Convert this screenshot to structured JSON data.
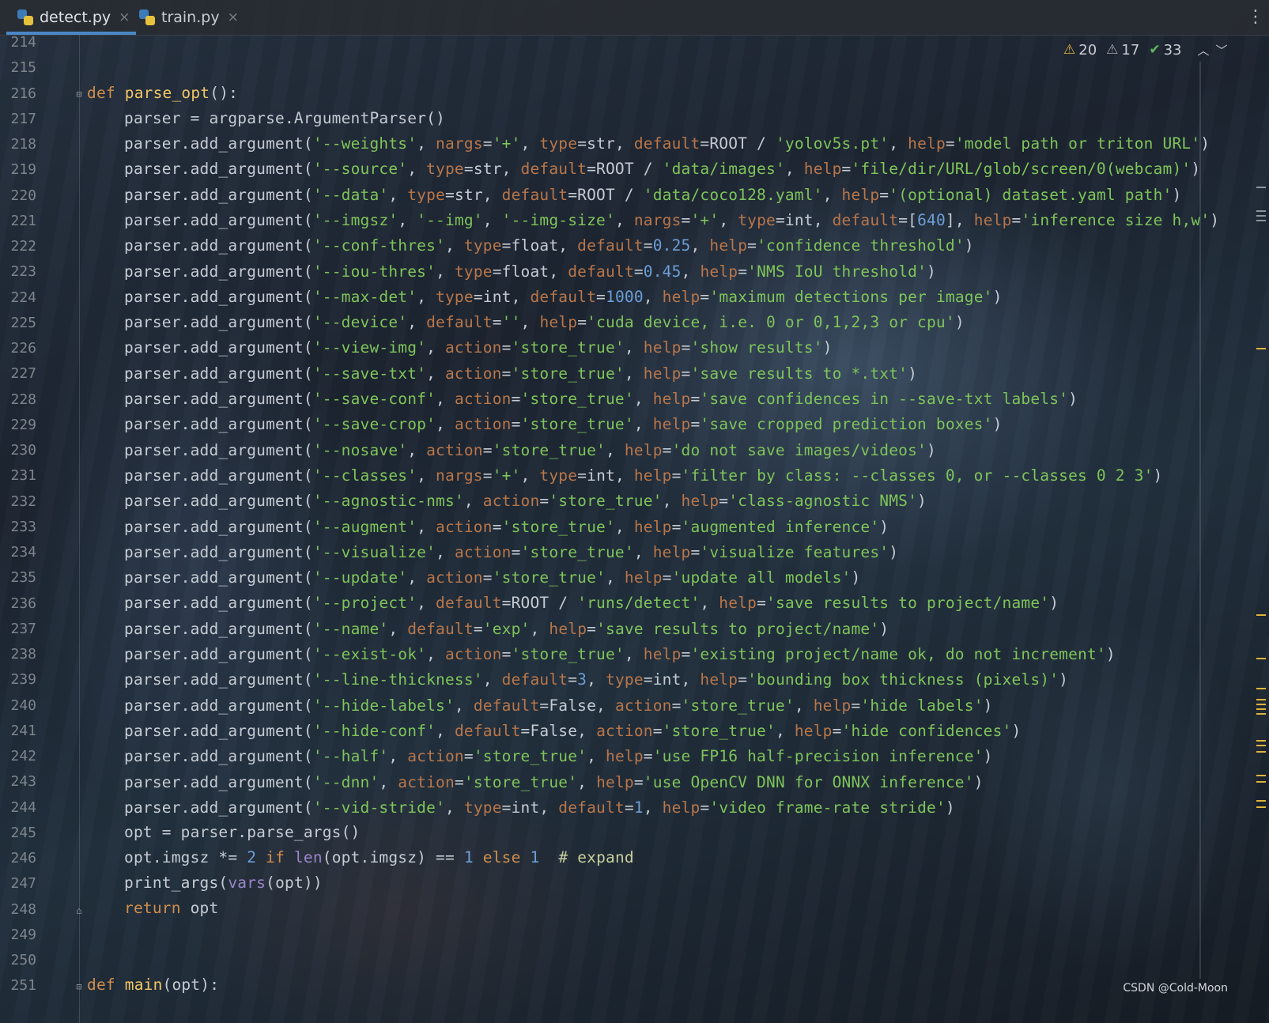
{
  "tabs": [
    {
      "label": "detect.py",
      "active": true
    },
    {
      "label": "train.py",
      "active": false
    }
  ],
  "inspections": {
    "warnings": "20",
    "weak_warnings": "17",
    "typos_ok": "33"
  },
  "colors": {
    "keyword": "#cf8e4c",
    "function": "#f1c666",
    "string": "#7fc45a",
    "number": "#6c9fd6",
    "kwarg": "#b8764a",
    "builtin": "#9b86c9",
    "accent": "#4a88c7"
  },
  "line_numbers": [
    "214",
    "215",
    "216",
    "217",
    "218",
    "219",
    "220",
    "221",
    "222",
    "223",
    "224",
    "225",
    "226",
    "227",
    "228",
    "229",
    "230",
    "231",
    "232",
    "233",
    "234",
    "235",
    "236",
    "237",
    "238",
    "239",
    "240",
    "241",
    "242",
    "243",
    "244",
    "245",
    "246",
    "247",
    "248",
    "249",
    "250",
    "251"
  ],
  "code": {
    "l216": {
      "kw": "def",
      "fn": "parse_opt",
      "rest": "():"
    },
    "l217": "parser = argparse.ArgumentParser()",
    "call": "parser.add_argument(",
    "l218": [
      "'--weights'",
      ", ",
      "nargs",
      "=",
      "'+'",
      ", ",
      "type",
      "=str, ",
      "default",
      "=ROOT / ",
      "'yolov5s.pt'",
      ", ",
      "help",
      "=",
      "'model path or triton URL'",
      ")"
    ],
    "l219": [
      "'--source'",
      ", ",
      "type",
      "=str, ",
      "default",
      "=ROOT / ",
      "'data/images'",
      ", ",
      "help",
      "=",
      "'file/dir/URL/glob/screen/0(webcam)'",
      ")"
    ],
    "l220": [
      "'--data'",
      ", ",
      "type",
      "=str, ",
      "default",
      "=ROOT / ",
      "'data/coco128.yaml'",
      ", ",
      "help",
      "=",
      "'(optional) dataset.yaml path'",
      ")"
    ],
    "l221": [
      "'--imgsz'",
      ", ",
      "'--img'",
      ", ",
      "'--img-size'",
      ", ",
      "nargs",
      "=",
      "'+'",
      ", ",
      "type",
      "=int, ",
      "default",
      "=[",
      "640",
      "], ",
      "help",
      "=",
      "'inference size h,w'",
      ")"
    ],
    "l222": [
      "'--conf-thres'",
      ", ",
      "type",
      "=float, ",
      "default",
      "=",
      "0.25",
      ", ",
      "help",
      "=",
      "'confidence threshold'",
      ")"
    ],
    "l223": [
      "'--iou-thres'",
      ", ",
      "type",
      "=float, ",
      "default",
      "=",
      "0.45",
      ", ",
      "help",
      "=",
      "'NMS IoU threshold'",
      ")"
    ],
    "l224": [
      "'--max-det'",
      ", ",
      "type",
      "=int, ",
      "default",
      "=",
      "1000",
      ", ",
      "help",
      "=",
      "'maximum detections per image'",
      ")"
    ],
    "l225": [
      "'--device'",
      ", ",
      "default",
      "=",
      "''",
      ", ",
      "help",
      "=",
      "'cuda device, i.e. 0 or 0,1,2,3 or cpu'",
      ")"
    ],
    "l226": [
      "'--view-img'",
      ", ",
      "action",
      "=",
      "'store_true'",
      ", ",
      "help",
      "=",
      "'show results'",
      ")"
    ],
    "l227": [
      "'--save-txt'",
      ", ",
      "action",
      "=",
      "'store_true'",
      ", ",
      "help",
      "=",
      "'save results to *.txt'",
      ")"
    ],
    "l228": [
      "'--save-conf'",
      ", ",
      "action",
      "=",
      "'store_true'",
      ", ",
      "help",
      "=",
      "'save confidences in --save-txt labels'",
      ")"
    ],
    "l229": [
      "'--save-crop'",
      ", ",
      "action",
      "=",
      "'store_true'",
      ", ",
      "help",
      "=",
      "'save cropped prediction boxes'",
      ")"
    ],
    "l230": [
      "'--nosave'",
      ", ",
      "action",
      "=",
      "'store_true'",
      ", ",
      "help",
      "=",
      "'do not save images/videos'",
      ")"
    ],
    "l231": [
      "'--classes'",
      ", ",
      "nargs",
      "=",
      "'+'",
      ", ",
      "type",
      "=int, ",
      "help",
      "=",
      "'filter by class: --classes 0, or --classes 0 2 3'",
      ")"
    ],
    "l232": [
      "'--agnostic-nms'",
      ", ",
      "action",
      "=",
      "'store_true'",
      ", ",
      "help",
      "=",
      "'class-agnostic NMS'",
      ")"
    ],
    "l233": [
      "'--augment'",
      ", ",
      "action",
      "=",
      "'store_true'",
      ", ",
      "help",
      "=",
      "'augmented inference'",
      ")"
    ],
    "l234": [
      "'--visualize'",
      ", ",
      "action",
      "=",
      "'store_true'",
      ", ",
      "help",
      "=",
      "'visualize features'",
      ")"
    ],
    "l235": [
      "'--update'",
      ", ",
      "action",
      "=",
      "'store_true'",
      ", ",
      "help",
      "=",
      "'update all models'",
      ")"
    ],
    "l236": [
      "'--project'",
      ", ",
      "default",
      "=ROOT / ",
      "'runs/detect'",
      ", ",
      "help",
      "=",
      "'save results to project/name'",
      ")"
    ],
    "l237": [
      "'--name'",
      ", ",
      "default",
      "=",
      "'exp'",
      ", ",
      "help",
      "=",
      "'save results to project/name'",
      ")"
    ],
    "l238": [
      "'--exist-ok'",
      ", ",
      "action",
      "=",
      "'store_true'",
      ", ",
      "help",
      "=",
      "'existing project/name ok, do not increment'",
      ")"
    ],
    "l239": [
      "'--line-thickness'",
      ", ",
      "default",
      "=",
      "3",
      ", ",
      "type",
      "=int, ",
      "help",
      "=",
      "'bounding box thickness (pixels)'",
      ")"
    ],
    "l240": [
      "'--hide-labels'",
      ", ",
      "default",
      "=False, ",
      "action",
      "=",
      "'store_true'",
      ", ",
      "help",
      "=",
      "'hide labels'",
      ")"
    ],
    "l241": [
      "'--hide-conf'",
      ", ",
      "default",
      "=False, ",
      "action",
      "=",
      "'store_true'",
      ", ",
      "help",
      "=",
      "'hide confidences'",
      ")"
    ],
    "l242": [
      "'--half'",
      ", ",
      "action",
      "=",
      "'store_true'",
      ", ",
      "help",
      "=",
      "'use FP16 half-precision inference'",
      ")"
    ],
    "l243": [
      "'--dnn'",
      ", ",
      "action",
      "=",
      "'store_true'",
      ", ",
      "help",
      "=",
      "'use OpenCV DNN for ONNX inference'",
      ")"
    ],
    "l244": [
      "'--vid-stride'",
      ", ",
      "type",
      "=int, ",
      "default",
      "=",
      "1",
      ", ",
      "help",
      "=",
      "'video frame-rate stride'",
      ")"
    ],
    "l245": "opt = parser.parse_args()",
    "l246": {
      "a": "opt.imgsz *= ",
      "n2": "2",
      " if_kw": " if ",
      "len": "len",
      "b": "(opt.imgsz) == ",
      "n1": "1",
      "else_kw": " else ",
      "n1b": "1",
      "comment": "  # expand"
    },
    "l247": {
      "fn": "print_args",
      "b1": "(",
      "bi": "vars",
      "b2": "(opt))"
    },
    "l248": {
      "kw": "return",
      "rest": " opt"
    },
    "l251": {
      "kw": "def",
      "fn": "main",
      "rest": "(opt):"
    }
  },
  "watermark": "CSDN @Cold-Moon"
}
